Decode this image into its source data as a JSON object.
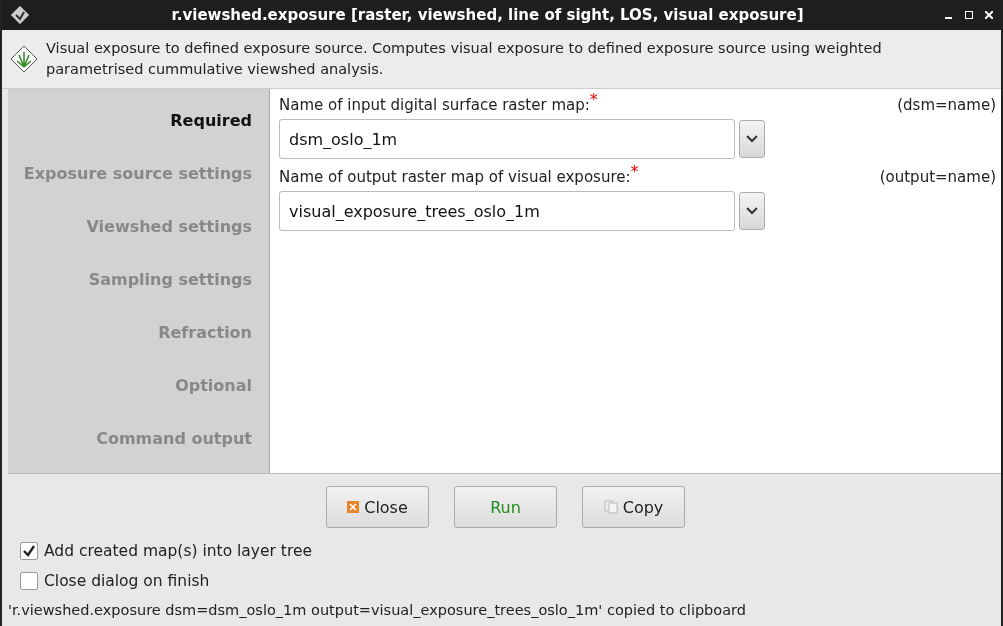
{
  "window": {
    "title": "r.viewshed.exposure [raster, viewshed, line of sight, LOS, visual exposure]"
  },
  "description": "Visual exposure to defined exposure source. Computes visual exposure to defined exposure source using weighted parametrised cummulative viewshed analysis.",
  "tabs": [
    {
      "label": "Required",
      "selected": true
    },
    {
      "label": "Exposure source settings",
      "selected": false
    },
    {
      "label": "Viewshed settings",
      "selected": false
    },
    {
      "label": "Sampling settings",
      "selected": false
    },
    {
      "label": "Refraction",
      "selected": false
    },
    {
      "label": "Optional",
      "selected": false
    },
    {
      "label": "Command output",
      "selected": false
    }
  ],
  "fields": [
    {
      "label": "Name of input digital surface raster map:",
      "required_mark": "*",
      "param": "(dsm=name)",
      "value": "dsm_oslo_1m"
    },
    {
      "label": "Name of output raster map of visual exposure:",
      "required_mark": "*",
      "param": "(output=name)",
      "value": "visual_exposure_trees_oslo_1m"
    }
  ],
  "buttons": [
    {
      "kind": "close",
      "label": "Close"
    },
    {
      "kind": "run",
      "label": "Run"
    },
    {
      "kind": "copy",
      "label": "Copy"
    }
  ],
  "options": [
    {
      "label": "Add created map(s) into layer tree",
      "checked": true
    },
    {
      "label": "Close dialog on finish",
      "checked": false
    }
  ],
  "status_bar": "'r.viewshed.exposure dsm=dsm_oslo_1m output=visual_exposure_trees_oslo_1m' copied to clipboard"
}
